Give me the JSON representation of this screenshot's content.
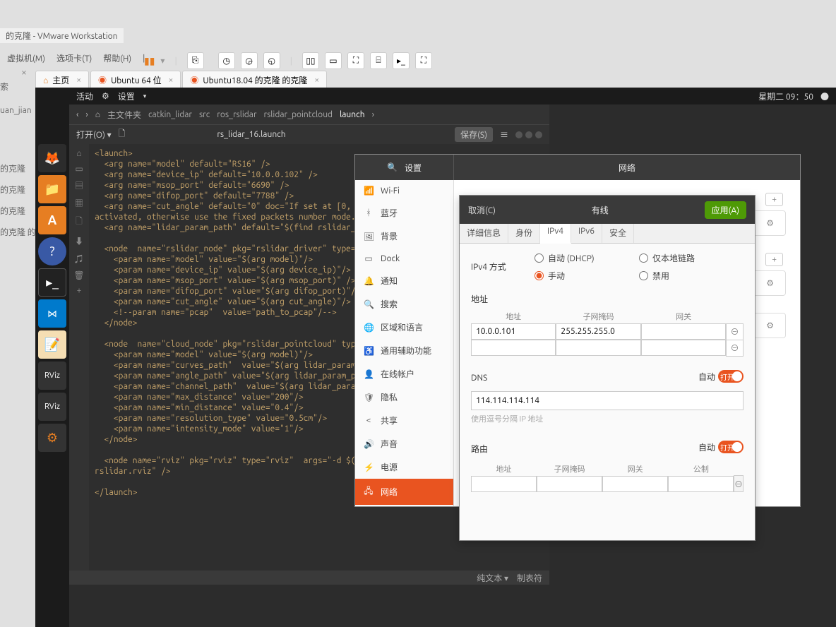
{
  "vmware": {
    "title": "的克隆 - VMware Workstation",
    "menu": {
      "vm": "虚拟机(M)",
      "tabs": "选项卡(T)",
      "help": "帮助(H)"
    },
    "tabs": {
      "home": "主页",
      "ubuntu": "Ubuntu 64 位",
      "clone": "Ubuntu18.04 的克隆 的克隆"
    },
    "side": {
      "close_x": "×",
      "search": "索",
      "p1": "uan_jian",
      "p2": "的克隆",
      "p3": "的克隆",
      "p4": "的克隆",
      "p5": "的克隆 的"
    }
  },
  "ubuntu": {
    "topbar": {
      "activities": "活动",
      "settings": "设置",
      "power_icon": "⏻",
      "clock": "星期二 09：50",
      "dot": "●"
    },
    "breadcrumb": {
      "back": "‹",
      "fwd": "›",
      "home_icon": "⌂",
      "home": "主文件夹",
      "p1": "catkin_lidar",
      "p2": "src",
      "p3": "ros_rslidar",
      "p4": "rslidar_pointcloud",
      "p5": "launch",
      "chev": "›"
    },
    "editor": {
      "open": "打开(O) ▾",
      "new_icon": "🗋",
      "filename": "rs_lidar_16.launch",
      "save": "保存(S)",
      "menu_icon": "≡",
      "status_a": "纯文本 ▾",
      "status_b": "制表符",
      "code": "<launch>\n  <arg name=\"model\" default=\"RS16\" />\n  <arg name=\"device_ip\" default=\"10.0.0.102\" />\n  <arg name=\"msop_port\" default=\"6690\" />\n  <arg name=\"difop_port\" default=\"7788\" />\n  <arg name=\"cut_angle\" default=\"0\" doc=\"If set at [0, 360), cut at specific angle feature\nactivated, otherwise use the fixed packets number mode.\"/>\n  <arg name=\"lidar_param_path\" default=\"$(find rslidar_pointcloud)/data/rs_lidar_16/\"/>\n\n  <node  name=\"rslidar_node\" pkg=\"rslidar_driver\" type=\"rslidar_no\n    <param name=\"model\" value=\"$(arg model)\"/>\n    <param name=\"device_ip\" value=\"$(arg device_ip)\"/>\n    <param name=\"msop_port\" value=\"$(arg msop_port)\" />\n    <param name=\"difop_port\" value=\"$(arg difop_port)\"/>\n    <param name=\"cut_angle\" value=\"$(arg cut_angle)\"/>\n    <!--param name=\"pcap\"  value=\"path_to_pcap\"/-->\n  </node>\n\n  <node  name=\"cloud_node\" pkg=\"rslidar_pointcloud\" type=\"cloud_no\n    <param name=\"model\" value=\"$(arg model)\"/>\n    <param name=\"curves_path\"  value=\"$(arg lidar_param_path)/curve\n    <param name=\"angle_path\" value=\"$(arg lidar_param_path)/angle\n    <param name=\"channel_path\"  value=\"$(arg lidar_param_path)/Chan\n    <param name=\"max_distance\" value=\"200\"/>\n    <param name=\"min_distance\" value=\"0.4\"/>\n    <param name=\"resolution_type\" value=\"0.5cm\"/>\n    <param name=\"intensity_mode\" value=\"1\"/>\n  </node>\n\n  <node name=\"rviz\" pkg=\"rviz\" type=\"rviz\"  args=\"-d $(find rslida\nrslidar.rviz\" />\n\n</launch>"
    }
  },
  "settings": {
    "search_icon": "🔍",
    "title_left": "设置",
    "title_right": "网络",
    "items": [
      {
        "icon": "📶",
        "label": "Wi-Fi"
      },
      {
        "icon": "ᚼ",
        "label": "蓝牙"
      },
      {
        "icon": "🖼",
        "label": "背景"
      },
      {
        "icon": "▭",
        "label": "Dock"
      },
      {
        "icon": "🔔",
        "label": "通知"
      },
      {
        "icon": "🔍",
        "label": "搜索"
      },
      {
        "icon": "🌐",
        "label": "区域和语言"
      },
      {
        "icon": "♿",
        "label": "通用辅助功能"
      },
      {
        "icon": "👤",
        "label": "在线帐户"
      },
      {
        "icon": "🛡",
        "label": "隐私"
      },
      {
        "icon": "<",
        "label": "共享"
      },
      {
        "icon": "🔊",
        "label": "声音"
      },
      {
        "icon": "⚡",
        "label": "电源"
      },
      {
        "icon": "🖧",
        "label": "网络"
      }
    ],
    "content": {
      "row1_plus": "+",
      "row1_gear": "⚙",
      "row2_gear": "⚙",
      "row2_plus": "+"
    }
  },
  "dialog": {
    "cancel": "取消(C)",
    "title": "有线",
    "apply": "应用(A)",
    "tabs": {
      "detail": "详细信息",
      "identity": "身份",
      "ipv4": "IPv4",
      "ipv6": "IPv6",
      "security": "安全"
    },
    "ipv4": {
      "method_label": "IPv4 方式",
      "opt_dhcp": "自动 (DHCP)",
      "opt_linklocal": "仅本地链路",
      "opt_manual": "手动",
      "opt_disable": "禁用"
    },
    "address": {
      "section": "地址",
      "col_addr": "地址",
      "col_mask": "子网掩码",
      "col_gw": "网关",
      "row1_addr": "10.0.0.101",
      "row1_mask": "255.255.255.0",
      "row1_gw": "",
      "del_icon": "⊖"
    },
    "dns": {
      "section": "DNS",
      "auto_label": "自动",
      "switch_on": "打开",
      "value": "114.114.114.114",
      "hint": "使用逗号分隔 IP 地址"
    },
    "route": {
      "section": "路由",
      "auto_label": "自动",
      "switch_on": "打开",
      "col_addr": "地址",
      "col_mask": "子网掩码",
      "col_gw": "网关",
      "col_metric": "公制",
      "del_icon": "⊖"
    }
  }
}
